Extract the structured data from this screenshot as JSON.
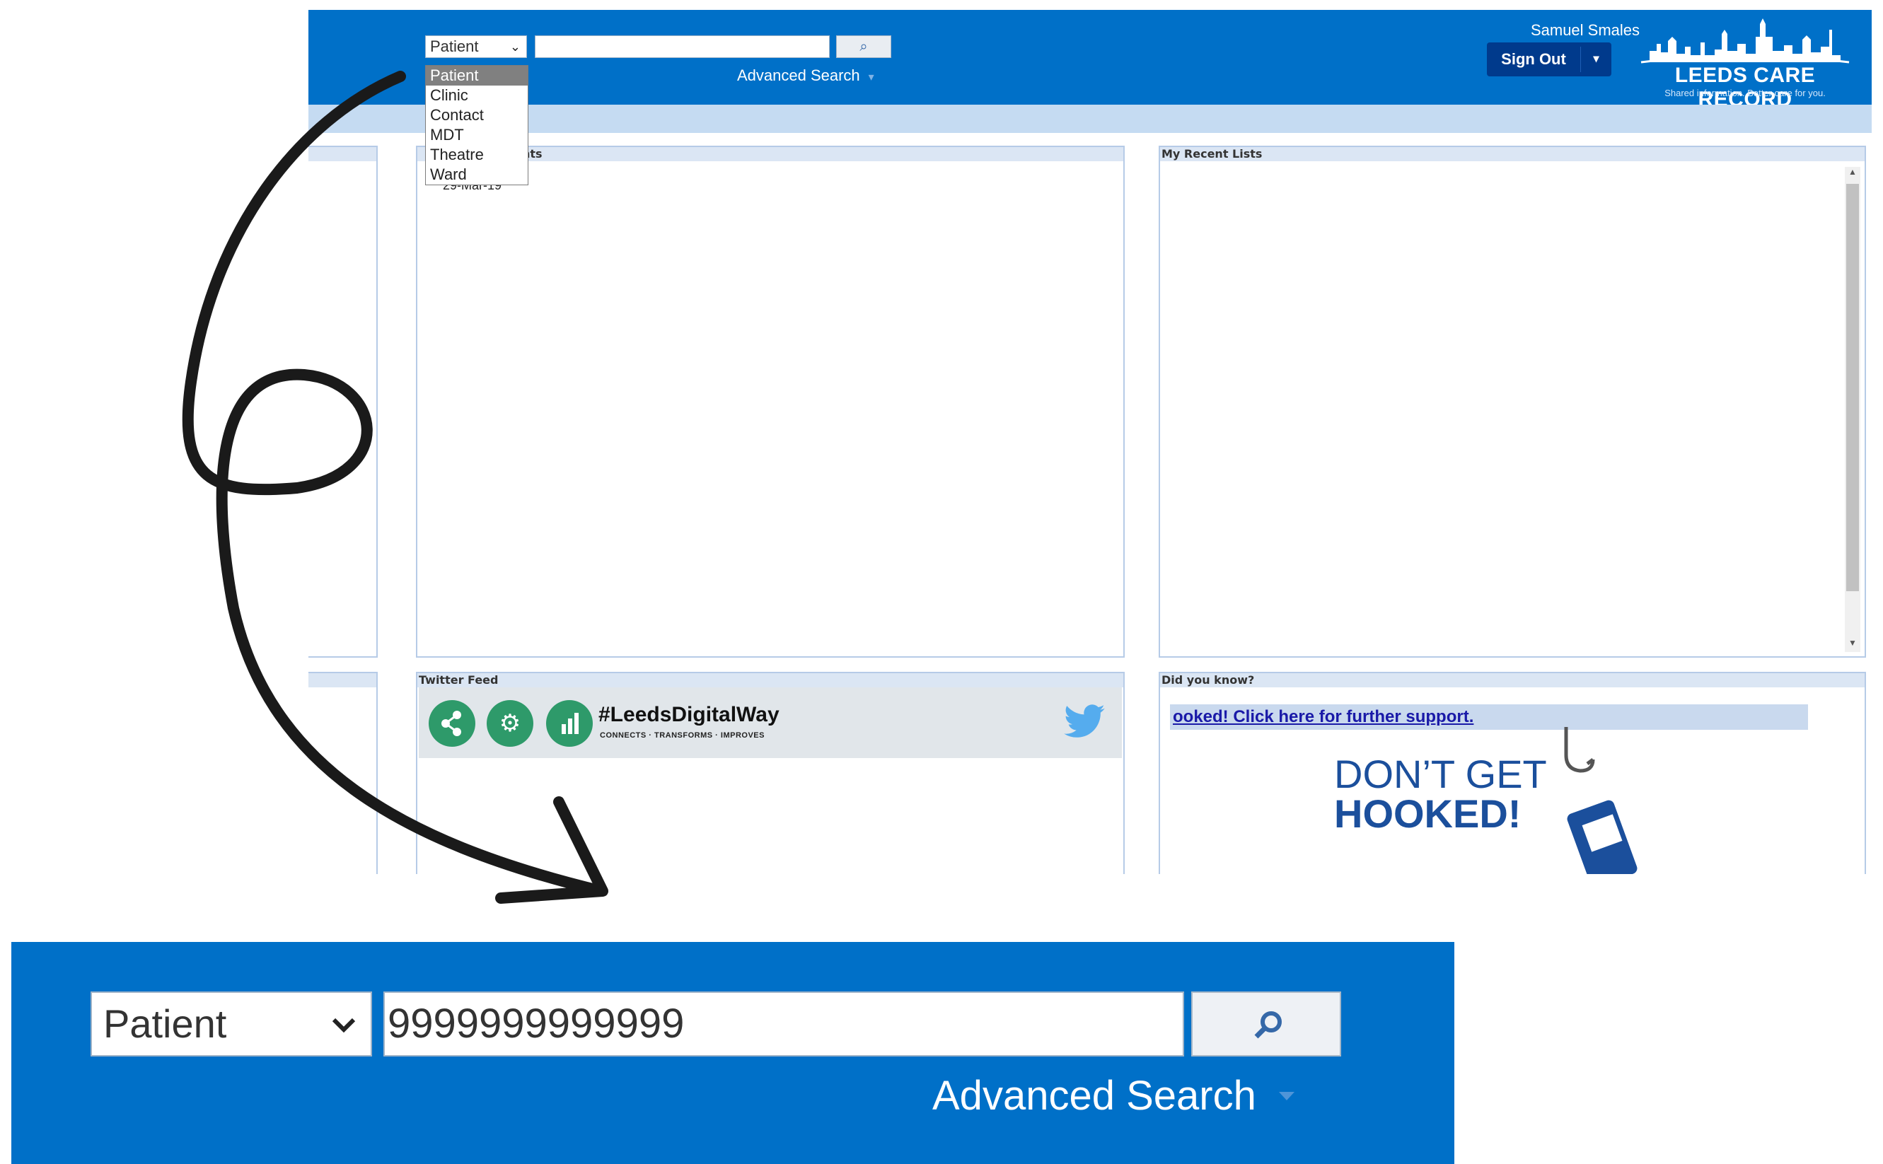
{
  "header": {
    "search_type": "Patient",
    "search_button_icon": "search-icon",
    "advanced_search": "Advanced Search",
    "user_name": "Samuel Smales",
    "sign_out": "Sign Out",
    "logo_title": "LEEDS CARE RECORD",
    "logo_tagline": "Shared information. Better care for you."
  },
  "dropdown": {
    "options": [
      "Patient",
      "Clinic",
      "Contact",
      "MDT",
      "Theatre",
      "Ward"
    ],
    "selected": "Patient"
  },
  "panels": {
    "recent_patients_title_fragment": "nts",
    "recent_patient_date": "29-Mar-19",
    "recent_lists_title": "My Recent Lists",
    "twitter_title": "Twitter Feed",
    "twitter_hashtag": "#LeedsDigitalWay",
    "twitter_tagline": "CONNECTS · TRANSFORMS · IMPROVES",
    "did_you_know_title": "Did you know?",
    "support_link": "ooked! Click here for further support.",
    "hooked_line1": "DON’T GET",
    "hooked_line2": "HOOKED!"
  },
  "zoom": {
    "search_type": "Patient",
    "search_value": "9999999999999",
    "advanced_search": "Advanced Search"
  },
  "colors": {
    "header_blue": "#0070c8",
    "sign_out_navy": "#003a8c",
    "twitter_green": "#2e9a6a",
    "hooked_blue": "#1b4f9c"
  }
}
